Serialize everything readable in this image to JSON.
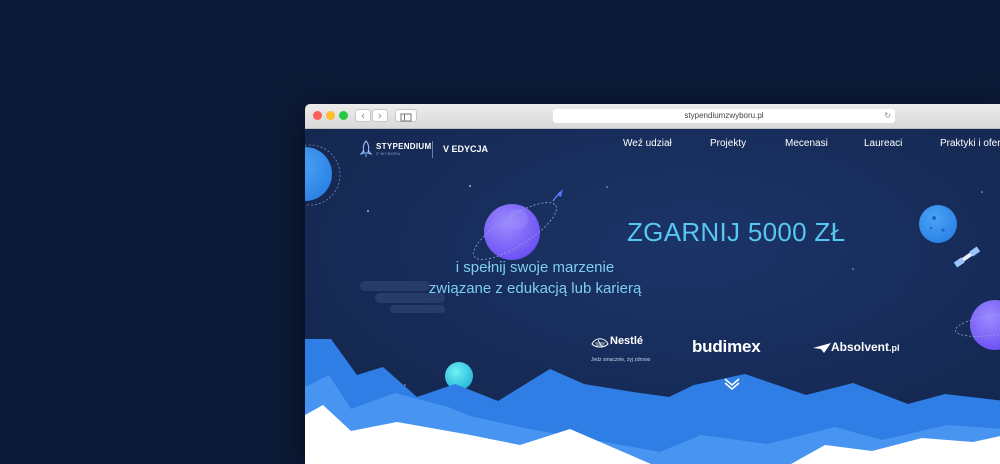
{
  "browser": {
    "url": "stypendiumzwyboru.pl",
    "colors": {
      "close": "#fe5f57",
      "minimize": "#febc2e",
      "zoom": "#28c840"
    }
  },
  "site": {
    "brand": {
      "name": "STYPENDIUM",
      "sub": "Z WYBORU",
      "edition": "V EDYCJA"
    },
    "menu": [
      "Weź udział",
      "Projekty",
      "Mecenasi",
      "Laureaci",
      "Praktyki i ofert"
    ],
    "hero": {
      "headline": "ZGARNIJ 5000 ZŁ",
      "subline_1": "i spełnij swoje marzenie",
      "subline_2": "związane z edukacją lub karierą"
    },
    "sponsors": {
      "nestle_name": "Nestlé",
      "nestle_tagline": "Jedz smacznie, żyj zdrowo",
      "budimex": "budimex",
      "absolvent": "Absolvent",
      "absolvent_suffix": ".pl"
    },
    "colors": {
      "background": "#162a56",
      "accent": "#59c7f1",
      "mountains": "#3b8bec"
    }
  }
}
